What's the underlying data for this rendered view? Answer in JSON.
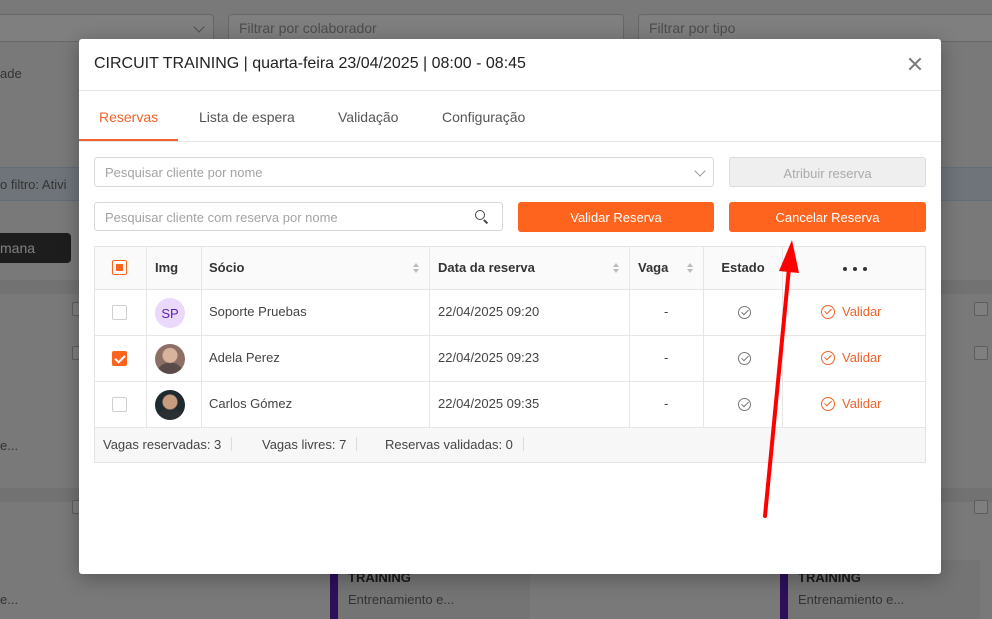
{
  "background": {
    "filter_colaborador_placeholder": "Filtrar por colaborador",
    "filter_tipo_placeholder": "Filtrar por tipo",
    "field_fragment": "ade",
    "band_text": "o filtro: Ativi",
    "week_button": "mana",
    "card_title": "TRAINING",
    "card_sub": "Entrenamiento e...",
    "left_fragment_1": "e...",
    "left_fragment_2": "e..."
  },
  "modal": {
    "title": "CIRCUIT TRAINING | quarta-feira 23/04/2025 | 08:00 - 08:45",
    "tabs": [
      {
        "label": "Reservas"
      },
      {
        "label": "Lista de espera"
      },
      {
        "label": "Validação"
      },
      {
        "label": "Configuração"
      }
    ],
    "search_client_placeholder": "Pesquisar cliente por nome",
    "search_reserved_placeholder": "Pesquisar cliente com reserva por nome",
    "assign_button": "Atribuir reserva",
    "validate_button": "Validar Reserva",
    "cancel_button": "Cancelar Reserva",
    "table": {
      "headers": {
        "img": "Img",
        "socio": "Sócio",
        "data": "Data da reserva",
        "vaga": "Vaga",
        "estado": "Estado"
      },
      "rows": [
        {
          "initials": "SP",
          "name": "Soporte Pruebas",
          "date": "22/04/2025 09:20",
          "vaga": "-",
          "action": "Validar",
          "checked": false
        },
        {
          "initials": "",
          "name": "Adela Perez",
          "date": "22/04/2025 09:23",
          "vaga": "-",
          "action": "Validar",
          "checked": true
        },
        {
          "initials": "",
          "name": "Carlos Gómez",
          "date": "22/04/2025 09:35",
          "vaga": "-",
          "action": "Validar",
          "checked": false
        }
      ]
    },
    "footer": {
      "reserved": "Vagas reservadas: 3",
      "free": "Vagas livres: 7",
      "validated": "Reservas validadas: 0"
    }
  },
  "colors": {
    "accent": "#ff641e",
    "annotation_arrow": "#ff0000"
  }
}
